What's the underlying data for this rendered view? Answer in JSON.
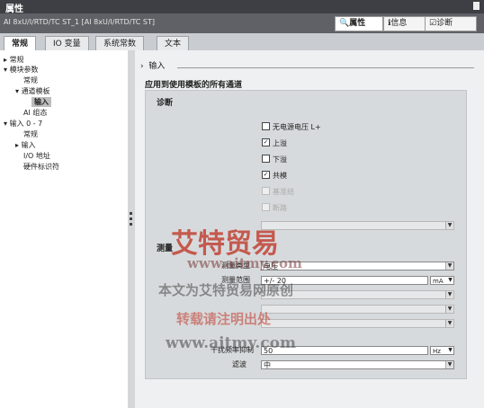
{
  "window": {
    "title": "属性",
    "module_path": "AI 8xU/I/RTD/TC ST_1 [AI 8xU/I/RTD/TC ST]"
  },
  "inspector_tabs": [
    {
      "label": "属性"
    },
    {
      "label": "信息"
    },
    {
      "label": "诊断"
    }
  ],
  "tabs": [
    {
      "label": "常规"
    },
    {
      "label": "IO 变量"
    },
    {
      "label": "系统常数"
    },
    {
      "label": "文本"
    }
  ],
  "tree": [
    {
      "label": "常规"
    },
    {
      "label": "模块参数"
    },
    {
      "label": "常规"
    },
    {
      "label": "通道模板"
    },
    {
      "label": "输入"
    },
    {
      "label": "AI 组态"
    },
    {
      "label": "输入 0 - 7"
    },
    {
      "label": "常规"
    },
    {
      "label": "输入"
    },
    {
      "label": "I/O 地址"
    },
    {
      "label": "硬件标识符"
    }
  ],
  "section": {
    "header": "输入",
    "caption": "应用到使用模板的所有通道"
  },
  "diagnostics": {
    "title": "诊断",
    "checkboxes": [
      {
        "label": "无电源电压 L+",
        "checked": false
      },
      {
        "label": "上溢",
        "checked": true
      },
      {
        "label": "下溢",
        "checked": false
      },
      {
        "label": "共模",
        "checked": true
      },
      {
        "label": "基准结",
        "checked": false
      },
      {
        "label": "断路",
        "checked": false
      }
    ]
  },
  "measurement": {
    "title": "测量",
    "fields": [
      {
        "label": "测量类型",
        "value": "电压"
      },
      {
        "label": "测量范围",
        "value": "+/- 20",
        "unit": "mA"
      },
      {
        "label": "干扰频率抑制",
        "value": "50",
        "unit": "Hz"
      },
      {
        "label": "滤波",
        "value": "中"
      }
    ]
  },
  "watermark": {
    "logo": "艾特贸易",
    "url": "www.aitmy.com",
    "line1": "本文为艾特贸易网原创",
    "line2": "转载请注明出处",
    "url2": "www.aitmy.com"
  }
}
